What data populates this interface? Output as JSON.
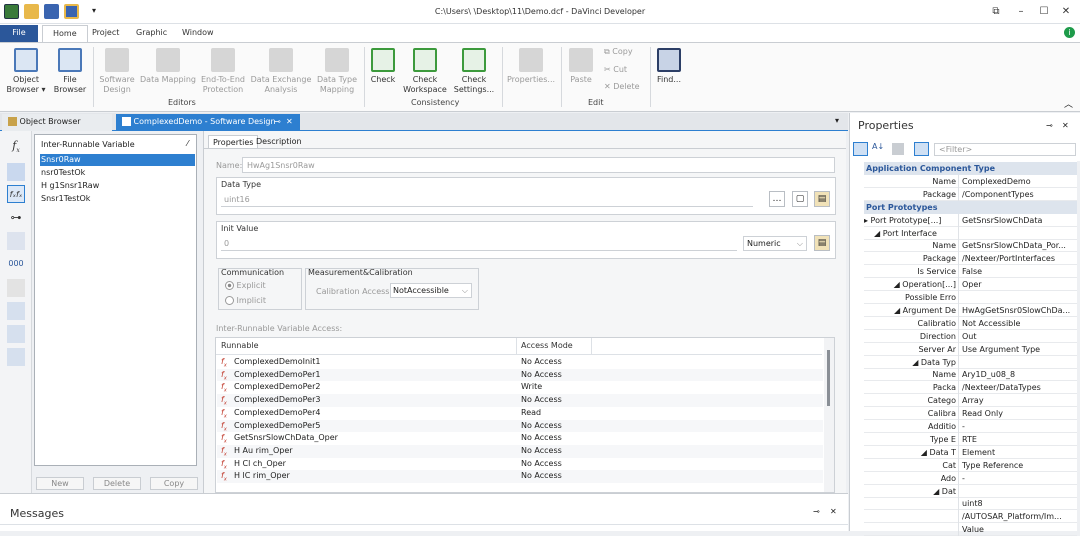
{
  "window": {
    "title": "C:\\Users\\      \\Desktop\\11\\Demo.dcf - DaVinci Developer",
    "quick_access_more": "▾"
  },
  "ribbon_tabs": [
    "File",
    "Home",
    "Project",
    "Graphic",
    "Window"
  ],
  "ribbon": {
    "buttons": [
      {
        "label": "Object\nBrowser ▾"
      },
      {
        "label": "File\nBrowser"
      },
      {
        "label": "Software\nDesign"
      },
      {
        "label": "Data Mapping"
      },
      {
        "label": "End-To-End\nProtection"
      },
      {
        "label": "Data Exchange\nAnalysis"
      },
      {
        "label": "Data Type\nMapping"
      },
      {
        "label": "Check"
      },
      {
        "label": "Check\nWorkspace"
      },
      {
        "label": "Check\nSettings..."
      },
      {
        "label": "Properties..."
      },
      {
        "label": "Paste"
      },
      {
        "label": "Find..."
      }
    ],
    "small_buttons": {
      "copy": "Copy",
      "cut": "Cut",
      "delete": "Delete"
    },
    "groups": {
      "editors": "Editors",
      "consistency": "Consistency",
      "edit": "Edit"
    }
  },
  "doc_tabs": {
    "object_browser": "Object Browser",
    "software_design": "ComplexedDemo - Software Design"
  },
  "irv_panel": {
    "header": "Inter-Runnable Variable",
    "items": [
      "       Snsr0Raw",
      "        nsr0TestOk",
      "H      g1Snsr1Raw",
      "         Snsr1TestOk"
    ],
    "buttons": {
      "new": "New",
      "delete": "Delete",
      "copy": "Copy"
    }
  },
  "editor": {
    "tabs": {
      "properties": "Properties",
      "description": "Description"
    },
    "name_label": "Name:",
    "name_value": "HwAg1Snsr0Raw",
    "data_type_label": "Data Type",
    "data_type_value": "uint16",
    "init_value_label": "Init Value",
    "init_value": "0",
    "init_format": "Numeric",
    "communication_label": "Communication",
    "explicit_label": "Explicit",
    "implicit_label": "Implicit",
    "measurement_label": "Measurement&Calibration",
    "calibration_access_label": "Calibration Access:",
    "calibration_access_value": "NotAccessible",
    "access_label": "Inter-Runnable Variable Access:",
    "table_headers": {
      "runnable": "Runnable",
      "access_mode": "Access Mode"
    },
    "table_rows": [
      {
        "runnable": "ComplexedDemoInit1",
        "mode": "No Access"
      },
      {
        "runnable": "ComplexedDemoPer1",
        "mode": "No Access"
      },
      {
        "runnable": "ComplexedDemoPer2",
        "mode": "Write"
      },
      {
        "runnable": "ComplexedDemoPer3",
        "mode": "No Access"
      },
      {
        "runnable": "ComplexedDemoPer4",
        "mode": "Read"
      },
      {
        "runnable": "ComplexedDemoPer5",
        "mode": "No Access"
      },
      {
        "runnable": "GetSnsrSlowChData_Oper",
        "mode": "No Access"
      },
      {
        "runnable": "H      Au   rim_Oper",
        "mode": "No Access"
      },
      {
        "runnable": "H      Cl   ch_Oper",
        "mode": "No Access"
      },
      {
        "runnable": "H      lC   rim_Oper",
        "mode": "No Access"
      }
    ]
  },
  "properties_panel": {
    "title": "Properties",
    "filter_placeholder": "<Filter>",
    "rows": [
      {
        "kind": "section",
        "key": "Application Component Type"
      },
      {
        "kind": "row",
        "key": "Name",
        "value": "ComplexedDemo",
        "indent": 0
      },
      {
        "kind": "row",
        "key": "Package",
        "value": "/ComponentTypes",
        "indent": 0
      },
      {
        "kind": "section",
        "key": "Port Prototypes"
      },
      {
        "kind": "row",
        "key": "▸ Port Prototype[...]",
        "value": "GetSnsrSlowChData",
        "indent": 0,
        "align": "left"
      },
      {
        "kind": "row",
        "key": "◢ Port Interface",
        "value": "",
        "indent": 1,
        "align": "left"
      },
      {
        "kind": "row",
        "key": "Name",
        "value": "GetSnsrSlowChData_Por...",
        "indent": 1
      },
      {
        "kind": "row",
        "key": "Package",
        "value": "/Nexteer/PortInterfaces",
        "indent": 1
      },
      {
        "kind": "row",
        "key": "Is Service",
        "value": "False",
        "indent": 1
      },
      {
        "kind": "row",
        "key": "◢ Operation[...]",
        "value": "Oper",
        "indent": 1
      },
      {
        "kind": "row",
        "key": "Possible Erro",
        "value": "",
        "indent": 2
      },
      {
        "kind": "row",
        "key": "◢ Argument De",
        "value": "HwAgGetSnsr0SlowChDa...",
        "indent": 2
      },
      {
        "kind": "row",
        "key": "Calibratio",
        "value": "Not Accessible",
        "indent": 3
      },
      {
        "kind": "row",
        "key": "Direction",
        "value": "Out",
        "indent": 3
      },
      {
        "kind": "row",
        "key": "Server Ar",
        "value": "Use Argument Type",
        "indent": 3
      },
      {
        "kind": "row",
        "key": "◢ Data Typ",
        "value": "",
        "indent": 3
      },
      {
        "kind": "row",
        "key": "Name",
        "value": "Ary1D_u08_8",
        "indent": 3
      },
      {
        "kind": "row",
        "key": "Packa",
        "value": "/Nexteer/DataTypes",
        "indent": 3
      },
      {
        "kind": "row",
        "key": "Catego",
        "value": "Array",
        "indent": 3
      },
      {
        "kind": "row",
        "key": "Calibra",
        "value": "Read Only",
        "indent": 3
      },
      {
        "kind": "row",
        "key": "Additio",
        "value": "-",
        "indent": 3
      },
      {
        "kind": "row",
        "key": "Type E",
        "value": "RTE",
        "indent": 3
      },
      {
        "kind": "row",
        "key": "◢ Data T",
        "value": "Element",
        "indent": 3
      },
      {
        "kind": "row",
        "key": "Cat",
        "value": "Type Reference",
        "indent": 4
      },
      {
        "kind": "row",
        "key": "Ado",
        "value": "-",
        "indent": 4
      },
      {
        "kind": "row",
        "key": "◢ Dat",
        "value": "",
        "indent": 4
      },
      {
        "kind": "row",
        "key": "",
        "value": "uint8",
        "indent": 4
      },
      {
        "kind": "row",
        "key": "",
        "value": "/AUTOSAR_Platform/Im...",
        "indent": 4
      },
      {
        "kind": "row",
        "key": "",
        "value": "Value",
        "indent": 4
      }
    ]
  },
  "messages": {
    "title": "Messages"
  },
  "colors": {
    "accent": "#2b579a",
    "selection": "#2d7fd0",
    "section_bg": "#dde4ed"
  }
}
